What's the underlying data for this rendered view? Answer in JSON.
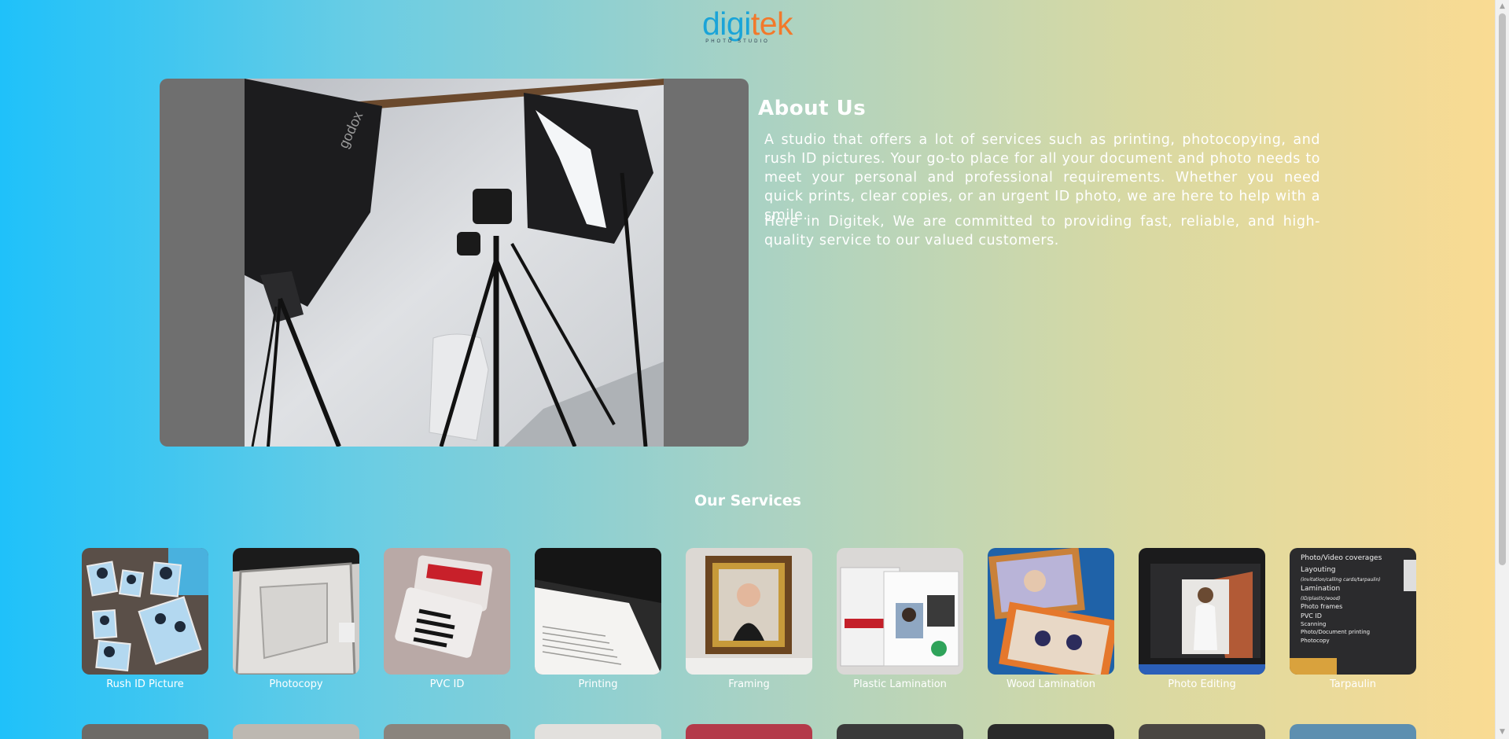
{
  "logo": {
    "word_part1": "digi",
    "word_part2": "tek",
    "subtitle": "PHOTO STUDIO",
    "colors": {
      "digi": "#1aa4d8",
      "tek": "#f2792b"
    }
  },
  "about": {
    "title": "About Us",
    "paragraph1": "A studio that offers a lot of services such as printing, photocopying, and rush ID pictures. Your go-to place for all your document and photo needs to meet your personal and professional requirements. Whether you need quick prints, clear copies, or an urgent ID photo, we are here to help with a smile.",
    "paragraph2": "Here in Digitek, We are committed to providing fast, reliable, and high-quality service to our valued customers.",
    "photo_label": "godox"
  },
  "services": {
    "title": "Our Services",
    "items": [
      {
        "label": "Rush ID Picture",
        "icon": "id-photos-image"
      },
      {
        "label": "Photocopy",
        "icon": "photocopier-image"
      },
      {
        "label": "PVC ID",
        "icon": "pvc-card-image"
      },
      {
        "label": "Printing",
        "icon": "printer-image"
      },
      {
        "label": "Framing",
        "icon": "framed-portrait-image"
      },
      {
        "label": "Plastic Lamination",
        "icon": "laminated-id-image"
      },
      {
        "label": "Wood Lamination",
        "icon": "wood-frame-image"
      },
      {
        "label": "Photo Editing",
        "icon": "monitor-editing-image"
      },
      {
        "label": "Tarpaulin",
        "icon": "tarpaulin-sign-image"
      }
    ],
    "tarpaulin_sign": {
      "line1": "Photo/Video coverages",
      "line2": "Layouting",
      "line3": "(invitation/calling cards/tarpaulin)",
      "line4": "Lamination",
      "line5": "(ID/plastic/wood)",
      "line6": "Photo frames",
      "line7": "PVC ID",
      "line8": "Scanning",
      "line9": "Photo/Document printing",
      "line10": "Photocopy"
    }
  },
  "colors": {
    "gradient_left": "#1fc1fa",
    "gradient_right": "#fbdb92",
    "photo_backdrop": "#6f6f6f"
  }
}
